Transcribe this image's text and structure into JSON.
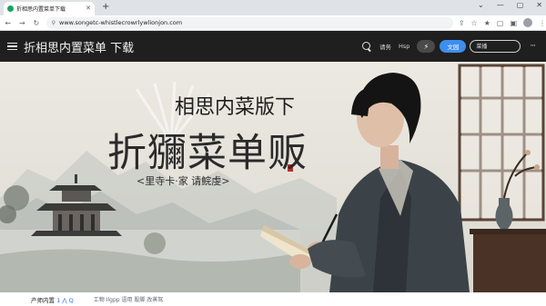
{
  "browser": {
    "tab": {
      "title": "折相思内置菜单下载",
      "favicon": "site-favicon-icon"
    },
    "url": "www.songetc-whistlecrowrlywlionjon.com",
    "accent": "#1aa260"
  },
  "header": {
    "title": "折相思内置菜单 下载",
    "links": [
      "请务",
      "Hsp"
    ],
    "primary_button": "文园",
    "search_placeholder": "菜播",
    "background": "#1f1f1f",
    "primary_color": "#3d8ef0"
  },
  "hero": {
    "subtitle": "相思内菜版下",
    "title": "折獼菜单贩",
    "tagline": "<里寺卡·家  请鯇虔>"
  },
  "bottom": {
    "left_text": "产师内置",
    "left_badge": "1 ⋀ Q",
    "right_text": "工物 Ilgpp 语用 股脚 改蒸驾"
  }
}
